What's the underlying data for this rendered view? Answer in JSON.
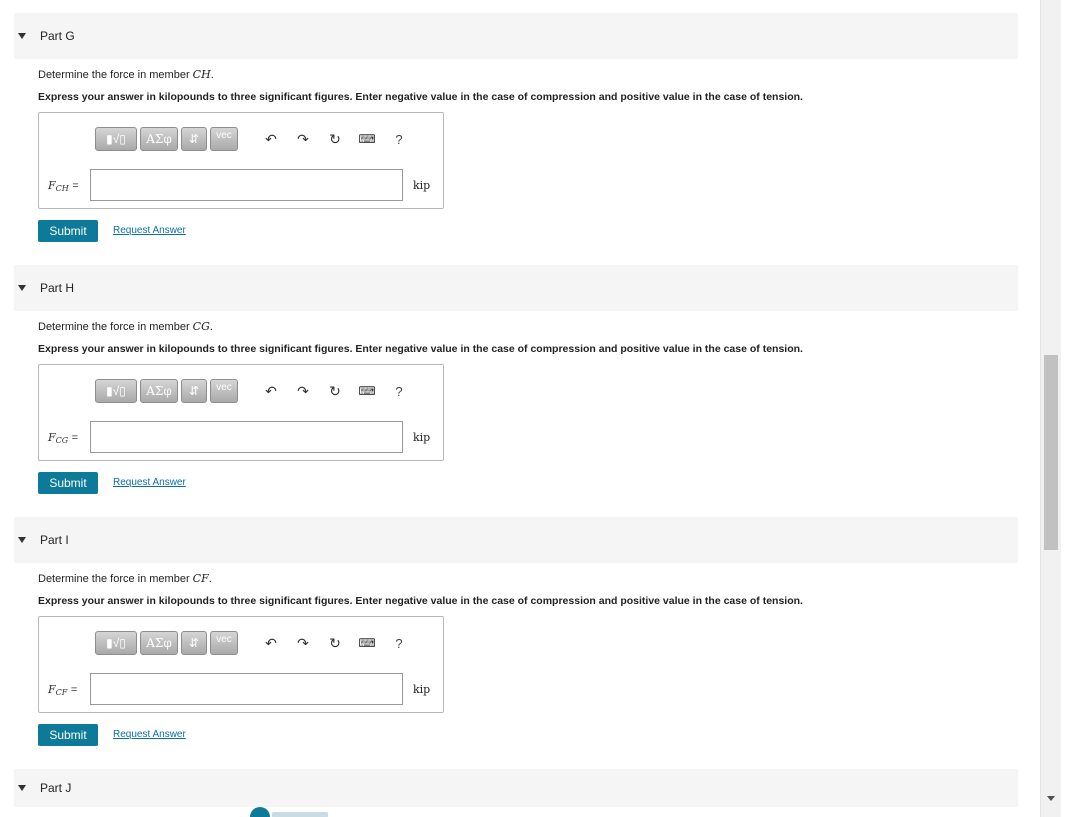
{
  "parts": [
    {
      "title": "Part G",
      "question_prefix": "Determine the force in member ",
      "member": "CH",
      "instructions": "Express your answer in kilopounds to three significant figures. Enter negative value in the case of compression and positive value in the case of tension.",
      "label_main": "F",
      "label_sub": "CH",
      "value": "",
      "unit": "kip",
      "submit": "Submit",
      "request": "Request Answer"
    },
    {
      "title": "Part H",
      "question_prefix": "Determine the force in member ",
      "member": "CG",
      "instructions": "Express your answer in kilopounds to three significant figures. Enter negative value in the case of compression and positive value in the case of tension.",
      "label_main": "F",
      "label_sub": "CG",
      "value": "",
      "unit": "kip",
      "submit": "Submit",
      "request": "Request Answer"
    },
    {
      "title": "Part I",
      "question_prefix": "Determine the force in member ",
      "member": "CF",
      "instructions": "Express your answer in kilopounds to three significant figures. Enter negative value in the case of compression and positive value in the case of tension.",
      "label_main": "F",
      "label_sub": "CF",
      "value": "",
      "unit": "kip",
      "submit": "Submit",
      "request": "Request Answer"
    },
    {
      "title": "Part J"
    }
  ],
  "toolbar": {
    "templates": "▮√▯",
    "greek": "ΑΣφ",
    "arrows": "⇵",
    "vec": "vec",
    "undo": "↶",
    "redo": "↷",
    "reset": "↻",
    "keyboard": "⌨",
    "help": "?"
  },
  "equals": "=",
  "colors": {
    "submit_bg": "#0d7a9a",
    "link": "#0b6ea8",
    "header_bg": "#f5f5f5"
  },
  "icons": {
    "toggle": "caret-down-icon",
    "undo": "undo-icon",
    "redo": "redo-icon",
    "reset": "reset-icon",
    "keyboard": "keyboard-icon",
    "help": "help-icon"
  }
}
